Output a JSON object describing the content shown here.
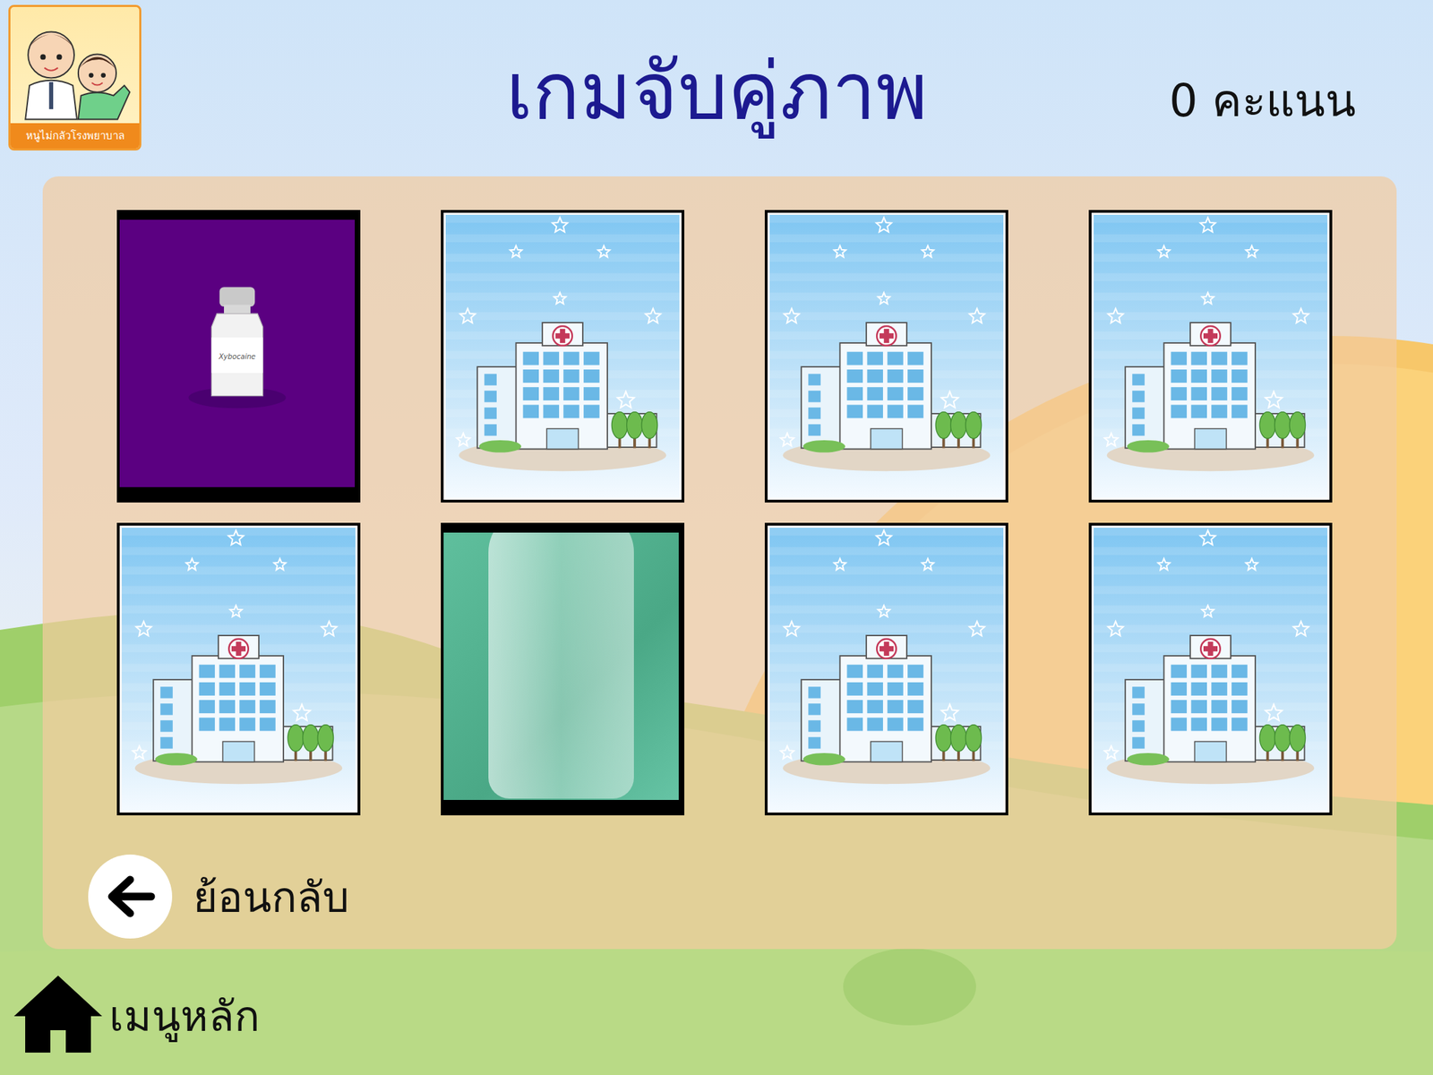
{
  "logo": {
    "text": "หนูไม่กลัวโรงพยาบาล"
  },
  "title": "เกมจับคู่ภาพ",
  "score": "0 คะแนน",
  "cards": [
    {
      "face_up": true,
      "kind": "drug-icon",
      "label": "Xybocaine"
    },
    {
      "face_up": false,
      "kind": "back"
    },
    {
      "face_up": false,
      "kind": "back"
    },
    {
      "face_up": false,
      "kind": "back"
    },
    {
      "face_up": false,
      "kind": "back"
    },
    {
      "face_up": true,
      "kind": "photo"
    },
    {
      "face_up": false,
      "kind": "back"
    },
    {
      "face_up": false,
      "kind": "back"
    }
  ],
  "back_button": "ย้อนกลับ",
  "home_button": "เมนูหลัก"
}
